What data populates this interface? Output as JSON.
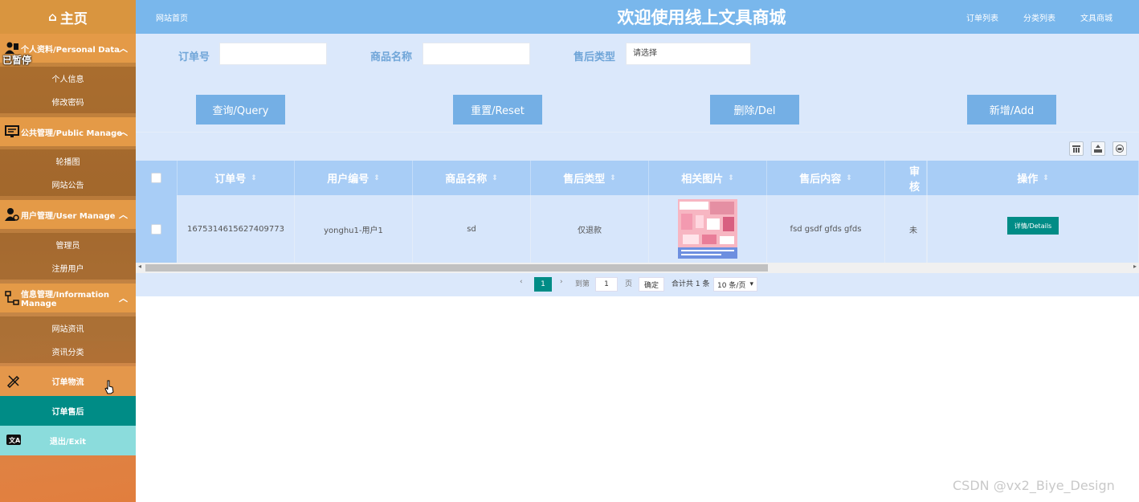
{
  "sidebar": {
    "home_label": "主页",
    "paused_overlay": "已暂停",
    "groups": [
      {
        "label": "个人资料/Personal Data",
        "items": [
          "个人信息",
          "修改密码"
        ]
      },
      {
        "label": "公共管理/Public Manage",
        "items": [
          "轮播图",
          "网站公告"
        ]
      },
      {
        "label": "用户管理/User Manage",
        "items": [
          "管理员",
          "注册用户"
        ]
      },
      {
        "label": "信息管理/Information Manage",
        "items": [
          "网站资讯",
          "资讯分类"
        ]
      }
    ],
    "singles": [
      {
        "label": "订单物流"
      },
      {
        "label": "订单售后"
      },
      {
        "label": "退出/Exit"
      }
    ],
    "colors": {
      "active": "#008c86",
      "exit": "#8bdcdc"
    }
  },
  "header": {
    "home_link": "网站首页",
    "title": "欢迎使用线上文具商城",
    "nav": [
      "订单列表",
      "分类列表",
      "文具商城"
    ]
  },
  "search": {
    "fields": [
      {
        "label": "订单号",
        "value": ""
      },
      {
        "label": "商品名称",
        "value": ""
      },
      {
        "label": "售后类型",
        "value": "请选择"
      }
    ],
    "buttons": [
      "查询/Query",
      "重置/Reset",
      "删除/Del",
      "新增/Add"
    ]
  },
  "table": {
    "columns": [
      "订单号",
      "用户编号",
      "商品名称",
      "售后类型",
      "相关图片",
      "售后内容",
      "审核",
      "操作"
    ],
    "rows": [
      {
        "order_no": "1675314615627409773",
        "user": "yonghu1-用户1",
        "product": "sd",
        "type": "仅退款",
        "image": "product-image",
        "content": "fsd gsdf gfds gfds",
        "audit": "未",
        "action": "详情/Details"
      }
    ]
  },
  "pager": {
    "current": "1",
    "goto_label": "到第",
    "goto_value": "1",
    "page_label": "页",
    "confirm": "确定",
    "total": "合计共 1 条",
    "per_page": "10 条/页"
  },
  "watermark": "CSDN @vx2_Biye_Design"
}
